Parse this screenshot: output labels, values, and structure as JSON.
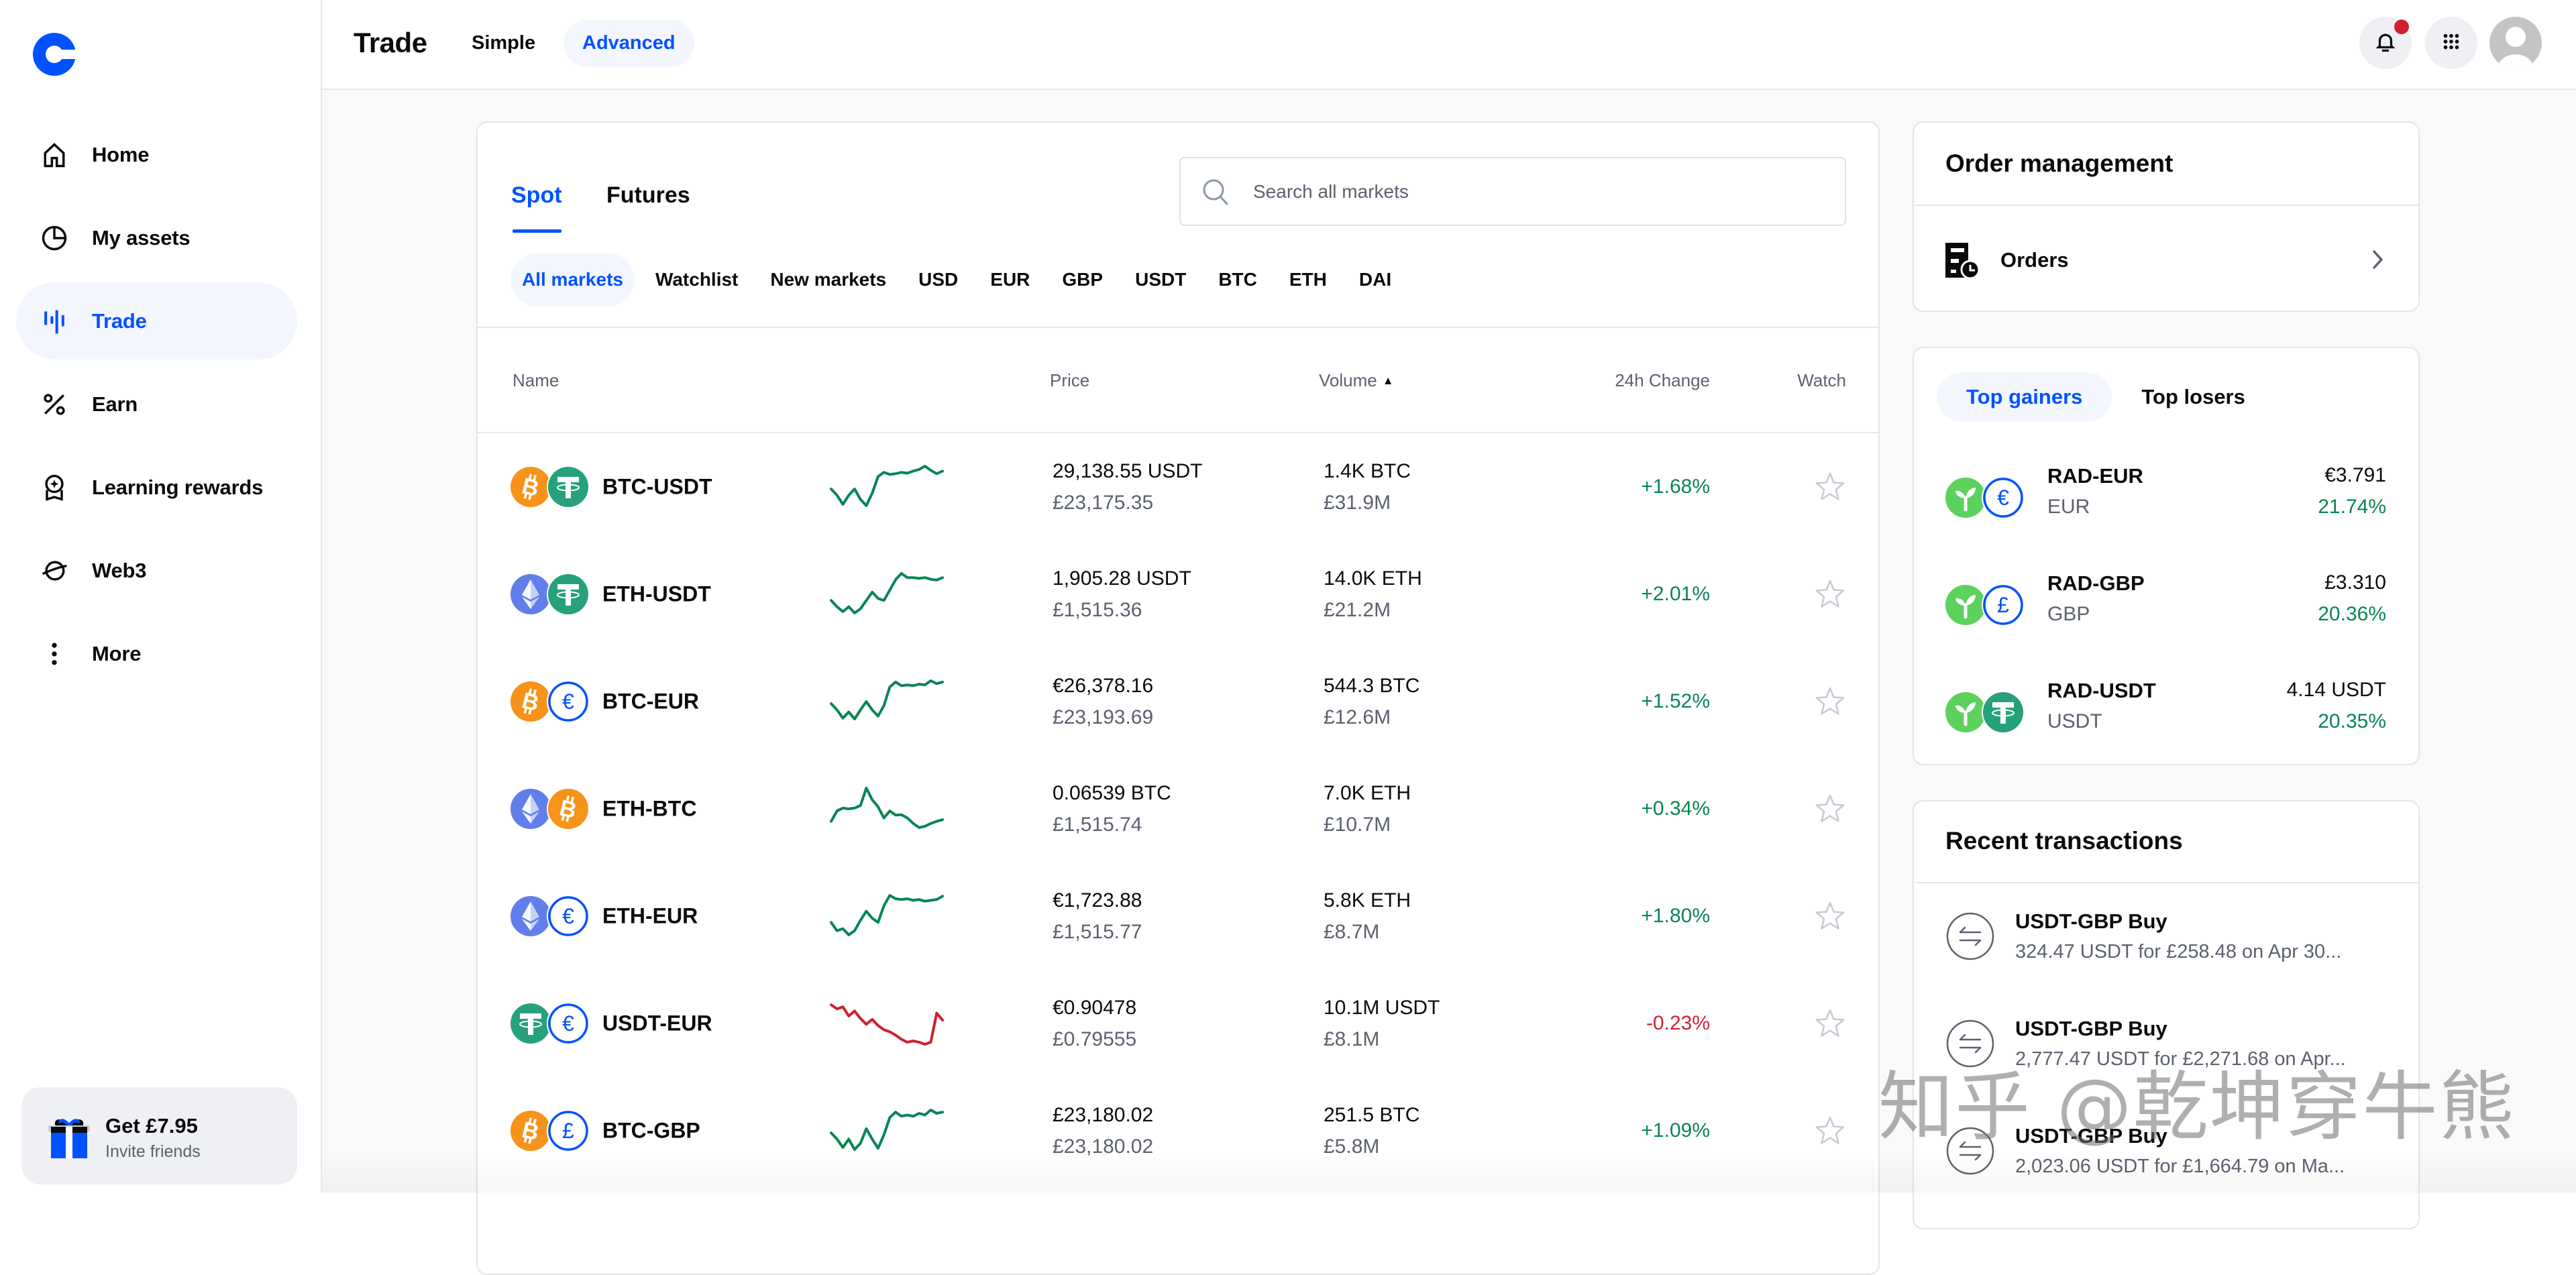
{
  "app": {
    "logo": "coinbase-logo"
  },
  "sidebar": {
    "items": [
      {
        "label": "Home",
        "icon": "home-icon",
        "active": false
      },
      {
        "label": "My assets",
        "icon": "pie-chart-icon",
        "active": false
      },
      {
        "label": "Trade",
        "icon": "trade-icon",
        "active": true
      },
      {
        "label": "Earn",
        "icon": "percent-icon",
        "active": false
      },
      {
        "label": "Learning rewards",
        "icon": "reward-badge-icon",
        "active": false
      },
      {
        "label": "Web3",
        "icon": "planet-icon",
        "active": false
      },
      {
        "label": "More",
        "icon": "more-vertical-icon",
        "active": false
      }
    ],
    "invite": {
      "title": "Get £7.95",
      "subtitle": "Invite friends",
      "icon": "gift-icon"
    }
  },
  "header": {
    "title": "Trade",
    "modes": [
      {
        "label": "Simple",
        "active": false
      },
      {
        "label": "Advanced",
        "active": true
      }
    ],
    "notifications": {
      "icon": "bell-icon",
      "has_unread": true
    },
    "apps_icon": "grid-icon",
    "avatar": "user-avatar"
  },
  "markets": {
    "tabs": [
      {
        "label": "Spot",
        "active": true
      },
      {
        "label": "Futures",
        "active": false
      }
    ],
    "search": {
      "placeholder": "Search all markets",
      "value": ""
    },
    "filters": [
      {
        "label": "All markets",
        "active": true
      },
      {
        "label": "Watchlist",
        "active": false
      },
      {
        "label": "New markets",
        "active": false
      },
      {
        "label": "USD",
        "active": false
      },
      {
        "label": "EUR",
        "active": false
      },
      {
        "label": "GBP",
        "active": false
      },
      {
        "label": "USDT",
        "active": false
      },
      {
        "label": "BTC",
        "active": false
      },
      {
        "label": "ETH",
        "active": false
      },
      {
        "label": "DAI",
        "active": false
      }
    ],
    "columns": {
      "name": "Name",
      "price": "Price",
      "volume": "Volume",
      "sort_indicator": "▲",
      "change": "24h Change",
      "watch": "Watch"
    },
    "rows": [
      {
        "pair": "BTC-USDT",
        "base": "BTC",
        "quote": "USDT",
        "price": "29,138.55 USDT",
        "price_gbp": "£23,175.35",
        "volume": "1.4K BTC",
        "volume_gbp": "£31.9M",
        "change": "+1.68%",
        "trend": "up",
        "watched": false,
        "sparkline": [
          0.45,
          0.3,
          0.08,
          0.3,
          0.45,
          0.2,
          0.05,
          0.35,
          0.75,
          0.85,
          0.8,
          0.82,
          0.85,
          0.83,
          0.88,
          0.92,
          1.0,
          0.9,
          0.82,
          0.88
        ]
      },
      {
        "pair": "ETH-USDT",
        "base": "ETH",
        "quote": "USDT",
        "price": "1,905.28 USDT",
        "price_gbp": "£1,515.36",
        "volume": "14.0K ETH",
        "volume_gbp": "£21.2M",
        "change": "+2.01%",
        "trend": "up",
        "watched": false,
        "sparkline": [
          0.35,
          0.2,
          0.08,
          0.2,
          0.05,
          0.15,
          0.35,
          0.55,
          0.4,
          0.35,
          0.6,
          0.85,
          1.0,
          0.9,
          0.9,
          0.88,
          0.9,
          0.86,
          0.84,
          0.9
        ]
      },
      {
        "pair": "BTC-EUR",
        "base": "BTC",
        "quote": "EUR",
        "price": "€26,378.16",
        "price_gbp": "£23,193.69",
        "volume": "544.3 BTC",
        "volume_gbp": "£12.6M",
        "change": "+1.52%",
        "trend": "up",
        "watched": false,
        "sparkline": [
          0.45,
          0.3,
          0.1,
          0.25,
          0.08,
          0.3,
          0.5,
          0.3,
          0.15,
          0.4,
          0.85,
          0.97,
          0.88,
          0.9,
          0.88,
          0.92,
          0.9,
          1.0,
          0.93,
          0.97
        ]
      },
      {
        "pair": "ETH-BTC",
        "base": "ETH",
        "quote": "BTC",
        "price": "0.06539 BTC",
        "price_gbp": "£1,515.74",
        "volume": "7.0K ETH",
        "volume_gbp": "£10.7M",
        "change": "+0.34%",
        "trend": "up",
        "watched": false,
        "sparkline": [
          0.2,
          0.45,
          0.52,
          0.5,
          0.52,
          0.58,
          1.0,
          0.72,
          0.55,
          0.28,
          0.45,
          0.35,
          0.36,
          0.28,
          0.15,
          0.05,
          0.08,
          0.15,
          0.2,
          0.24
        ]
      },
      {
        "pair": "ETH-EUR",
        "base": "ETH",
        "quote": "EUR",
        "price": "€1,723.88",
        "price_gbp": "£1,515.77",
        "volume": "5.8K ETH",
        "volume_gbp": "£8.7M",
        "change": "+1.80%",
        "trend": "up",
        "watched": false,
        "sparkline": [
          0.35,
          0.15,
          0.2,
          0.05,
          0.15,
          0.4,
          0.62,
          0.45,
          0.35,
          0.75,
          1.0,
          0.92,
          0.9,
          0.92,
          0.88,
          0.9,
          0.86,
          0.88,
          0.9,
          0.98
        ]
      },
      {
        "pair": "USDT-EUR",
        "base": "USDT",
        "quote": "EUR",
        "price": "€0.90478",
        "price_gbp": "£0.79555",
        "volume": "10.1M USDT",
        "volume_gbp": "£8.1M",
        "change": "-0.23%",
        "trend": "down",
        "watched": false,
        "sparkline": [
          0.95,
          0.85,
          0.9,
          0.68,
          0.8,
          0.62,
          0.48,
          0.6,
          0.45,
          0.35,
          0.3,
          0.22,
          0.12,
          0.05,
          0.08,
          0.05,
          0.0,
          0.05,
          0.75,
          0.58
        ]
      },
      {
        "pair": "BTC-GBP",
        "base": "BTC",
        "quote": "GBP",
        "price": "£23,180.02",
        "price_gbp": "£23,180.02",
        "volume": "251.5 BTC",
        "volume_gbp": "£5.8M",
        "change": "+1.09%",
        "trend": "up",
        "watched": false,
        "sparkline": [
          0.45,
          0.3,
          0.1,
          0.3,
          0.05,
          0.2,
          0.55,
          0.3,
          0.08,
          0.4,
          0.82,
          0.95,
          0.85,
          0.88,
          0.85,
          0.92,
          0.88,
          1.0,
          0.92,
          0.95
        ]
      }
    ]
  },
  "order_management": {
    "title": "Order management",
    "items": [
      {
        "label": "Orders",
        "icon": "orders-icon"
      }
    ]
  },
  "movers": {
    "tabs": [
      {
        "label": "Top gainers",
        "active": true
      },
      {
        "label": "Top losers",
        "active": false
      }
    ],
    "rows": [
      {
        "pair": "RAD-EUR",
        "base": "RAD",
        "quote": "EUR",
        "quote_label": "EUR",
        "price": "€3.791",
        "change": "21.74%"
      },
      {
        "pair": "RAD-GBP",
        "base": "RAD",
        "quote": "GBP",
        "quote_label": "GBP",
        "price": "£3.310",
        "change": "20.36%"
      },
      {
        "pair": "RAD-USDT",
        "base": "RAD",
        "quote": "USDT",
        "quote_label": "USDT",
        "price": "4.14 USDT",
        "change": "20.35%"
      }
    ]
  },
  "recent_transactions": {
    "title": "Recent transactions",
    "items": [
      {
        "title": "USDT-GBP Buy",
        "detail": "324.47 USDT for £258.48 on Apr 30..."
      },
      {
        "title": "USDT-GBP Buy",
        "detail": "2,777.47 USDT for £2,271.68 on Apr..."
      },
      {
        "title": "USDT-GBP Buy",
        "detail": "2,023.06 USDT for £1,664.79 on Ma..."
      }
    ]
  },
  "colors": {
    "brand": "#0052FF",
    "positive": "#098551",
    "negative": "#CF202F",
    "text": "#0A0B0D",
    "muted": "#5B616E"
  },
  "watermark": "知乎 @乾坤穿牛熊"
}
